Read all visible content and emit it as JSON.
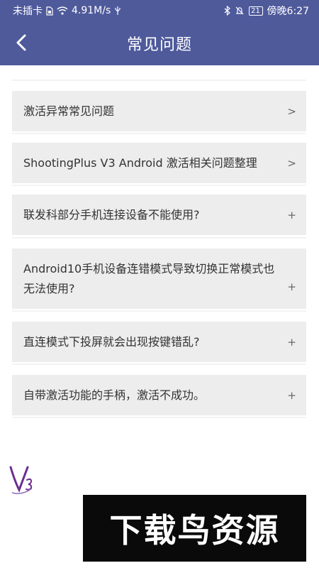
{
  "status_bar": {
    "carrier": "未插卡",
    "speed": "4.91M/s",
    "battery": "21",
    "time": "傍晚6:27",
    "icons": [
      "sim-icon",
      "wifi-icon",
      "usb-icon",
      "bluetooth-icon",
      "mute-icon",
      "battery-icon"
    ]
  },
  "header": {
    "title": "常见问题",
    "back_icon": "back-chevron-icon"
  },
  "faq": {
    "items": [
      {
        "label": "激活异常常见问题",
        "mark": ">"
      },
      {
        "label": "ShootingPlus V3 Android 激活相关问题整理",
        "mark": ">"
      },
      {
        "label": "联发科部分手机连接设备不能使用?",
        "mark": "+"
      },
      {
        "label": "Android10手机设备连错模式导致切换正常模式也无法使用?",
        "mark": "+"
      },
      {
        "label": "直连模式下投屏就会出现按键错乱?",
        "mark": "+"
      },
      {
        "label": "自带激活功能的手柄，激活不成功。",
        "mark": "+"
      }
    ]
  },
  "logo": {
    "text": "V3"
  },
  "watermark": {
    "text": "下载鸟资源"
  },
  "colors": {
    "header": "#4f5a9b",
    "item_bg": "#ededed"
  }
}
